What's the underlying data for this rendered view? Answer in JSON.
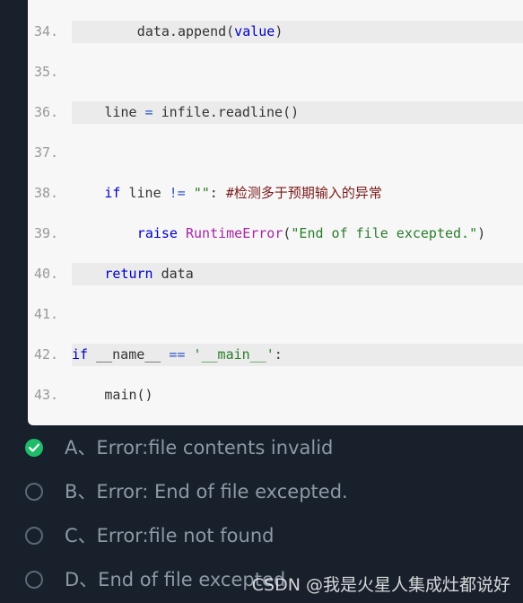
{
  "code_lines": [
    {
      "num": "34.",
      "shaded": true,
      "indent": 8,
      "tokens": [
        {
          "t": "data.append(",
          "c": "plain"
        },
        {
          "t": "value",
          "c": "kw"
        },
        {
          "t": ")",
          "c": "plain"
        }
      ]
    },
    {
      "num": "35.",
      "shaded": false,
      "indent": 0,
      "tokens": []
    },
    {
      "num": "36.",
      "shaded": true,
      "indent": 4,
      "tokens": [
        {
          "t": "line",
          "c": "plain"
        },
        {
          "t": " = ",
          "c": "op"
        },
        {
          "t": "infile.readline()",
          "c": "plain"
        }
      ]
    },
    {
      "num": "37.",
      "shaded": false,
      "indent": 0,
      "tokens": []
    },
    {
      "num": "38.",
      "shaded": false,
      "indent": 4,
      "tokens": [
        {
          "t": "if",
          "c": "kw"
        },
        {
          "t": " line ",
          "c": "plain"
        },
        {
          "t": "!=",
          "c": "op"
        },
        {
          "t": " ",
          "c": "plain"
        },
        {
          "t": "\"\"",
          "c": "str"
        },
        {
          "t": ": ",
          "c": "plain"
        },
        {
          "t": "#检测多于预期输入的异常",
          "c": "cm"
        }
      ]
    },
    {
      "num": "39.",
      "shaded": false,
      "indent": 8,
      "tokens": [
        {
          "t": "raise",
          "c": "kw"
        },
        {
          "t": " ",
          "c": "plain"
        },
        {
          "t": "RuntimeError",
          "c": "fn"
        },
        {
          "t": "(",
          "c": "plain"
        },
        {
          "t": "\"End of file excepted.\"",
          "c": "str"
        },
        {
          "t": ")",
          "c": "plain"
        }
      ]
    },
    {
      "num": "40.",
      "shaded": true,
      "indent": 4,
      "tokens": [
        {
          "t": "return",
          "c": "kw"
        },
        {
          "t": " data",
          "c": "plain"
        }
      ]
    },
    {
      "num": "41.",
      "shaded": false,
      "indent": 0,
      "tokens": []
    },
    {
      "num": "42.",
      "shaded": true,
      "indent": 0,
      "tokens": [
        {
          "t": "if",
          "c": "kw"
        },
        {
          "t": " __name__ ",
          "c": "plain"
        },
        {
          "t": "==",
          "c": "op"
        },
        {
          "t": " ",
          "c": "plain"
        },
        {
          "t": "'__main__'",
          "c": "str"
        },
        {
          "t": ":",
          "c": "plain"
        }
      ]
    },
    {
      "num": "43.",
      "shaded": false,
      "indent": 4,
      "tokens": [
        {
          "t": "main()",
          "c": "plain"
        }
      ]
    }
  ],
  "options": [
    {
      "label": "A、Error:file contents invalid",
      "selected": true
    },
    {
      "label": "B、Error: End of file excepted.",
      "selected": false
    },
    {
      "label": "C、Error:file not found",
      "selected": false
    },
    {
      "label": "D、End of file excepted",
      "selected": false
    }
  ],
  "watermark": "CSDN @我是火星人集成灶都说好",
  "colors": {
    "background": "#17202b",
    "code_background": "#f7f7f7",
    "selected": "#1fbd69",
    "option_text": "#8d99a6"
  }
}
